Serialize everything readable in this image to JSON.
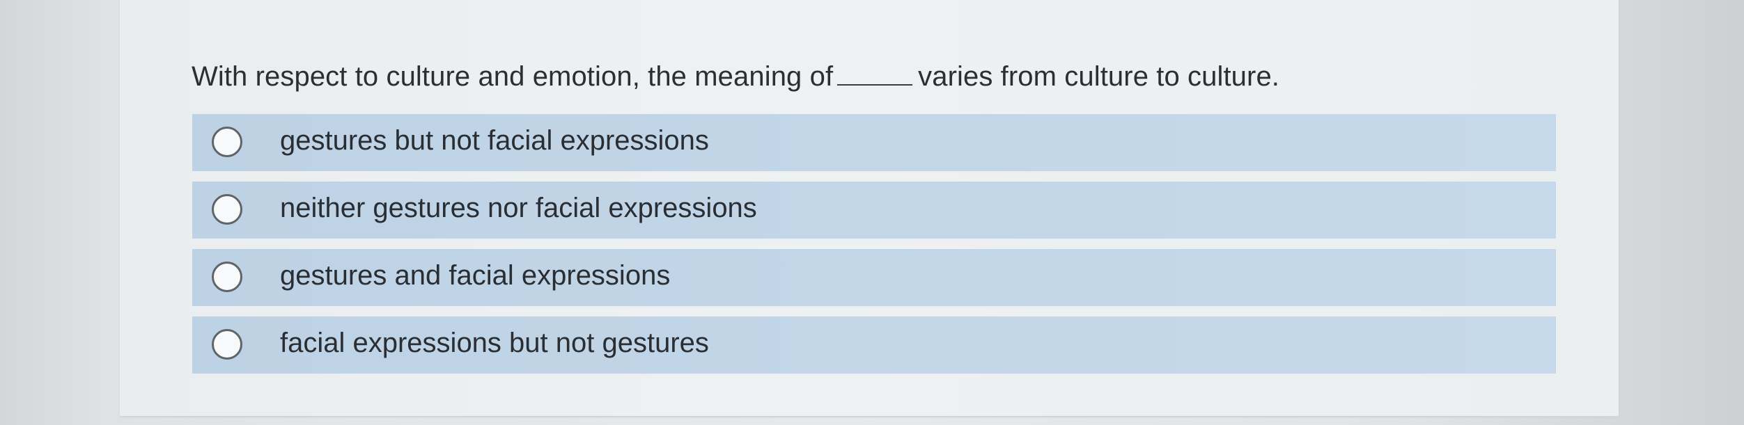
{
  "question": {
    "prefix": "With respect to culture and emotion, the meaning of",
    "suffix": "varies from culture to culture."
  },
  "options": [
    {
      "label": "gestures but not facial expressions",
      "selected": false
    },
    {
      "label": "neither gestures nor facial expressions",
      "selected": false
    },
    {
      "label": "gestures and facial expressions",
      "selected": false
    },
    {
      "label": "facial expressions but not gestures",
      "selected": false
    }
  ]
}
